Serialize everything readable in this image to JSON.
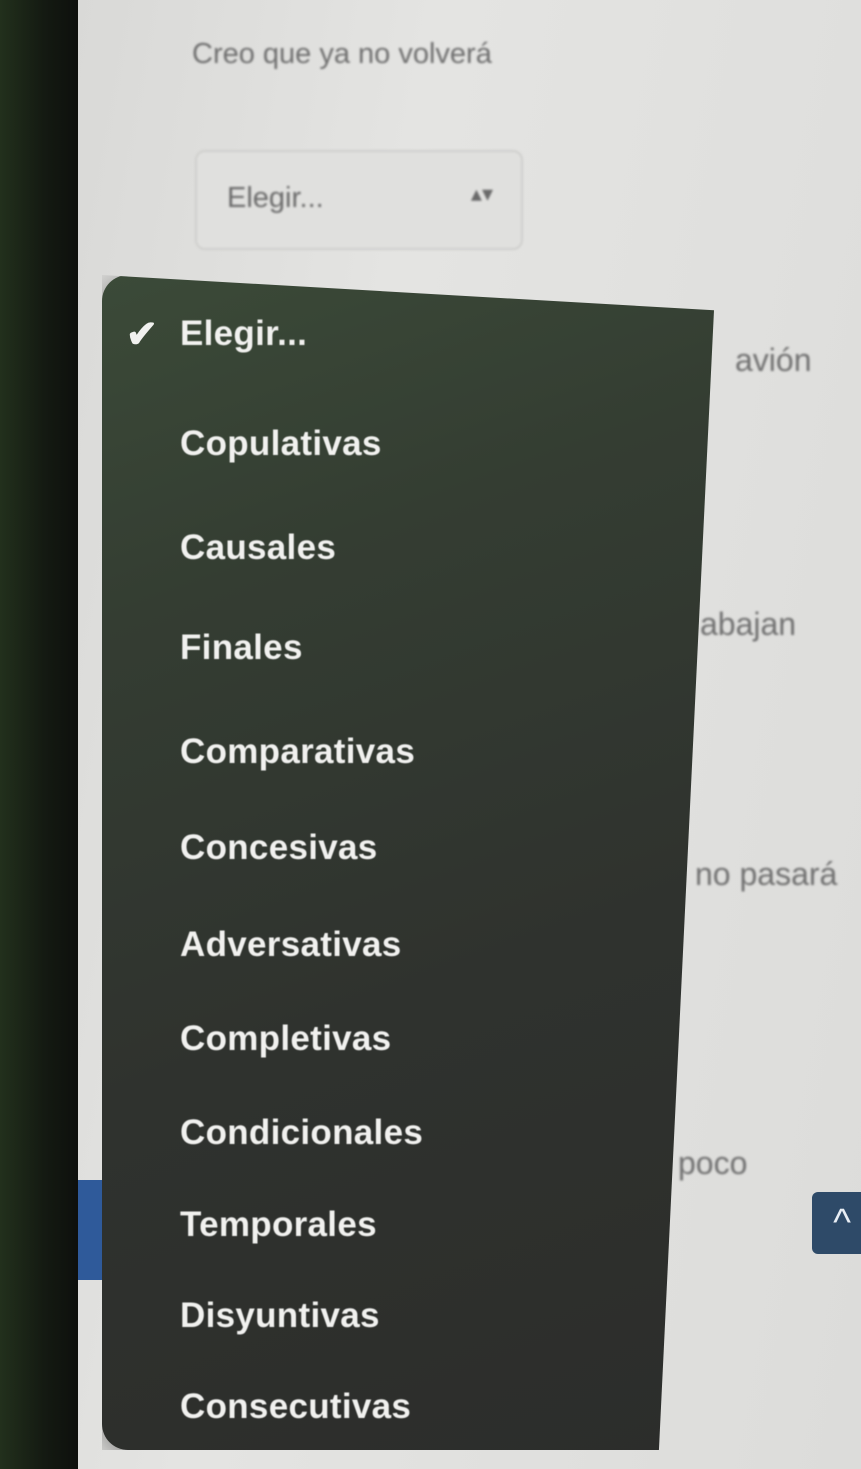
{
  "question": {
    "text": "Creo que ya no volverá"
  },
  "select": {
    "value": "Elegir...",
    "arrows": "▴▾"
  },
  "background_fragments": [
    "avión",
    "abajan",
    "no pasará",
    "poco"
  ],
  "scroll_top": {
    "icon": "chevron-up-icon",
    "glyph": "^"
  },
  "dropdown": {
    "check_glyph": "✔",
    "selected_index": 0,
    "options": [
      "Elegir...",
      "Copulativas",
      "Causales",
      "Finales",
      "Comparativas",
      "Concesivas",
      "Adversativas",
      "Completivas",
      "Condicionales",
      "Temporales",
      "Disyuntivas",
      "Consecutivas"
    ]
  }
}
